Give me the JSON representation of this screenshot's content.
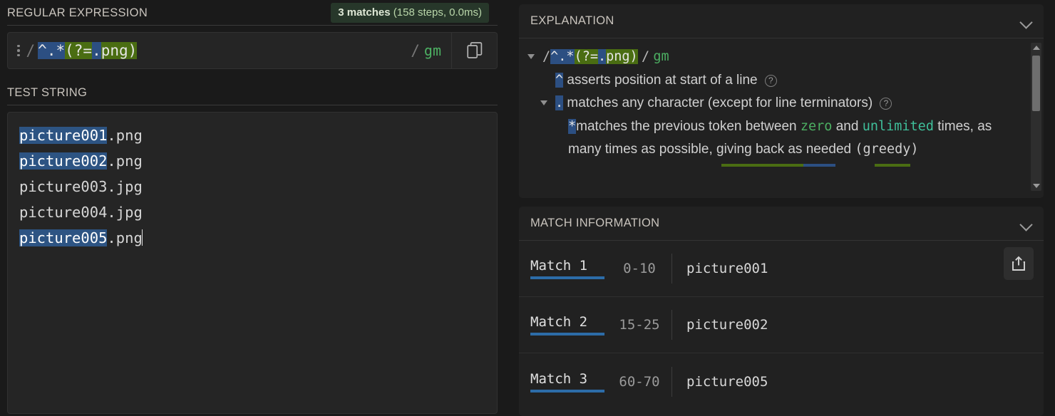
{
  "regex_section": {
    "title": "REGULAR EXPRESSION",
    "badge": {
      "matches": "3 matches",
      "stats": "(158 steps, 0.0ms)"
    },
    "delimiter": "/",
    "pattern_tokens": [
      {
        "text": "^",
        "style": "blue"
      },
      {
        "text": ".",
        "style": "blue"
      },
      {
        "text": "*",
        "style": "blue"
      },
      {
        "text": "(?=",
        "style": "green"
      },
      {
        "text": ".",
        "style": "blue"
      },
      {
        "text": "png",
        "style": "green-plain"
      },
      {
        "text": ")",
        "style": "green"
      }
    ],
    "pattern_plain": "^.*(?=.png)",
    "flags": "gm",
    "copy_icon": "copy-icon",
    "handle_icon": "drag-handle-icon"
  },
  "test_section": {
    "title": "TEST STRING",
    "lines": [
      {
        "match": "picture001",
        "rest": ".png",
        "highlighted": true
      },
      {
        "match": "picture002",
        "rest": ".png",
        "highlighted": true
      },
      {
        "match": "picture003",
        "rest": ".jpg",
        "highlighted": false
      },
      {
        "match": "picture004",
        "rest": ".jpg",
        "highlighted": false
      },
      {
        "match": "picture005",
        "rest": ".png",
        "highlighted": true,
        "caret": true
      }
    ]
  },
  "explanation": {
    "title": "EXPLANATION",
    "collapse_icon": "chevron-down-icon",
    "header_row": {
      "delimiter": "/",
      "flags": "gm"
    },
    "rows": [
      {
        "token": "^",
        "token_style": "blue",
        "text": "asserts position at start of a line",
        "help": true,
        "triangle": false
      },
      {
        "token": ".",
        "token_style": "blue",
        "text": "matches any character (except for line terminators)",
        "help": true,
        "triangle": true
      },
      {
        "token": "*",
        "token_style": "blue",
        "text_parts": [
          {
            "text": "matches the previous token between ",
            "style": "plain"
          },
          {
            "text": "zero",
            "style": "green-mono"
          },
          {
            "text": " and ",
            "style": "plain"
          },
          {
            "text": "unlimited",
            "style": "teal-mono"
          },
          {
            "text": " times, as many times as possible, giving back as needed ",
            "style": "plain"
          },
          {
            "text": "(greedy)",
            "style": "mono"
          }
        ],
        "help": false,
        "triangle": false
      }
    ],
    "scrollbar": {
      "up_icon": "scroll-up-arrow-icon",
      "down_icon": "scroll-down-arrow-icon",
      "thumb": "scroll-thumb"
    }
  },
  "match_information": {
    "title": "MATCH INFORMATION",
    "collapse_icon": "chevron-down-icon",
    "export_icon": "share-export-icon",
    "matches": [
      {
        "label": "Match 1",
        "range": "0-10",
        "value": "picture001"
      },
      {
        "label": "Match 2",
        "range": "15-25",
        "value": "picture002"
      },
      {
        "label": "Match 3",
        "range": "60-70",
        "value": "picture005"
      }
    ]
  },
  "colors": {
    "page_bg": "#1a1a1a",
    "panel_bg": "#212121",
    "input_bg": "#252525",
    "match_badge_bg": "#27372a",
    "highlight_blue": "#2d5483",
    "token_blue": "#2c4f82",
    "token_green": "#4a6d12",
    "flag_green": "#4caf62",
    "underline_blue": "#2c6ca8"
  }
}
